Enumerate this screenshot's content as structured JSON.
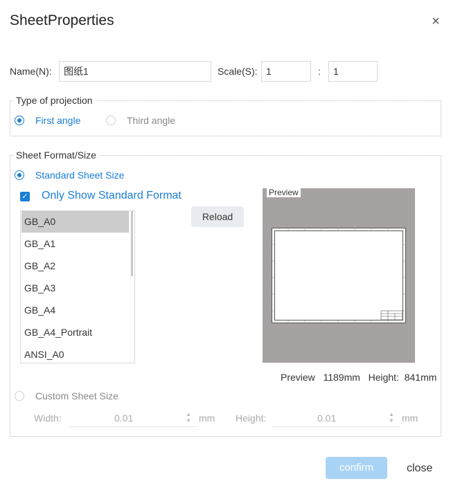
{
  "dialog": {
    "title": "SheetProperties",
    "close_glyph": "×"
  },
  "name_row": {
    "name_label": "Name(N):",
    "name_value": "图纸1",
    "scale_label": "Scale(S):",
    "scale_left": "1",
    "scale_sep": ":",
    "scale_right": "1"
  },
  "projection": {
    "legend": "Type of projection",
    "first_angle": "First angle",
    "third_angle": "Third angle",
    "selected": "first"
  },
  "sheet_format": {
    "legend": "Sheet Format/Size",
    "standard_label": "Standard Sheet Size",
    "only_standard_label": "Only Show Standard Format",
    "only_standard_checked": true,
    "reload_label": "Reload",
    "formats": [
      "GB_A0",
      "GB_A1",
      "GB_A2",
      "GB_A3",
      "GB_A4",
      "GB_A4_Portrait",
      "ANSI_A0"
    ],
    "selected_format": "GB_A0",
    "preview_label": "Preview",
    "preview_info": {
      "prefix": "Preview",
      "width": "1189mm",
      "height_label": "Height:",
      "height": "841mm"
    },
    "custom_label": "Custom Sheet Size",
    "width_label": "Width:",
    "width_value": "0.01",
    "width_unit": "mm",
    "height_label": "Height:",
    "height_value": "0.01",
    "height_unit": "mm"
  },
  "footer": {
    "confirm_label": "confirm",
    "close_label": "close"
  },
  "colors": {
    "accent": "#1a7ed6",
    "confirm_disabled": "#a9d3f5",
    "preview_bg": "#a6a2a2"
  }
}
